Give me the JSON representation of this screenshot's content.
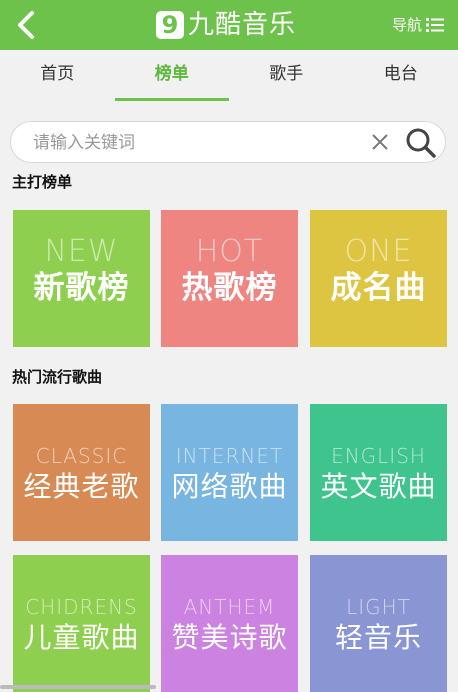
{
  "header": {
    "logo_number": "9",
    "logo_text": "九酷音乐",
    "nav_label": "导航"
  },
  "tabs": [
    {
      "label": "首页"
    },
    {
      "label": "榜单"
    },
    {
      "label": "歌手"
    },
    {
      "label": "电台"
    }
  ],
  "search": {
    "placeholder": "请输入关键词",
    "value": ""
  },
  "section_main": {
    "title": "主打榜单",
    "tiles": [
      {
        "en": "NEW",
        "zh": "新歌榜",
        "color": "#8fcf4f"
      },
      {
        "en": "HOT",
        "zh": "热歌榜",
        "color": "#ee8580"
      },
      {
        "en": "ONE",
        "zh": "成名曲",
        "color": "#ddc441"
      }
    ]
  },
  "section_popular": {
    "title": "热门流行歌曲",
    "tiles": [
      {
        "en": "CLASSIC",
        "zh": "经典老歌",
        "color": "#d88a55"
      },
      {
        "en": "INTERNET",
        "zh": "网络歌曲",
        "color": "#78b5e0"
      },
      {
        "en": "ENGLISH",
        "zh": "英文歌曲",
        "color": "#40c48d"
      },
      {
        "en": "CHIDRENS",
        "zh": "儿童歌曲",
        "color": "#8fcf4f"
      },
      {
        "en": "ANTHEM",
        "zh": "赞美诗歌",
        "color": "#cc82e0"
      },
      {
        "en": "LIGHT",
        "zh": "轻音乐",
        "color": "#8a95d3"
      }
    ]
  },
  "icons": {
    "back": "chevron-left-icon",
    "nav": "list-icon",
    "clear": "close-icon",
    "search": "search-icon"
  }
}
